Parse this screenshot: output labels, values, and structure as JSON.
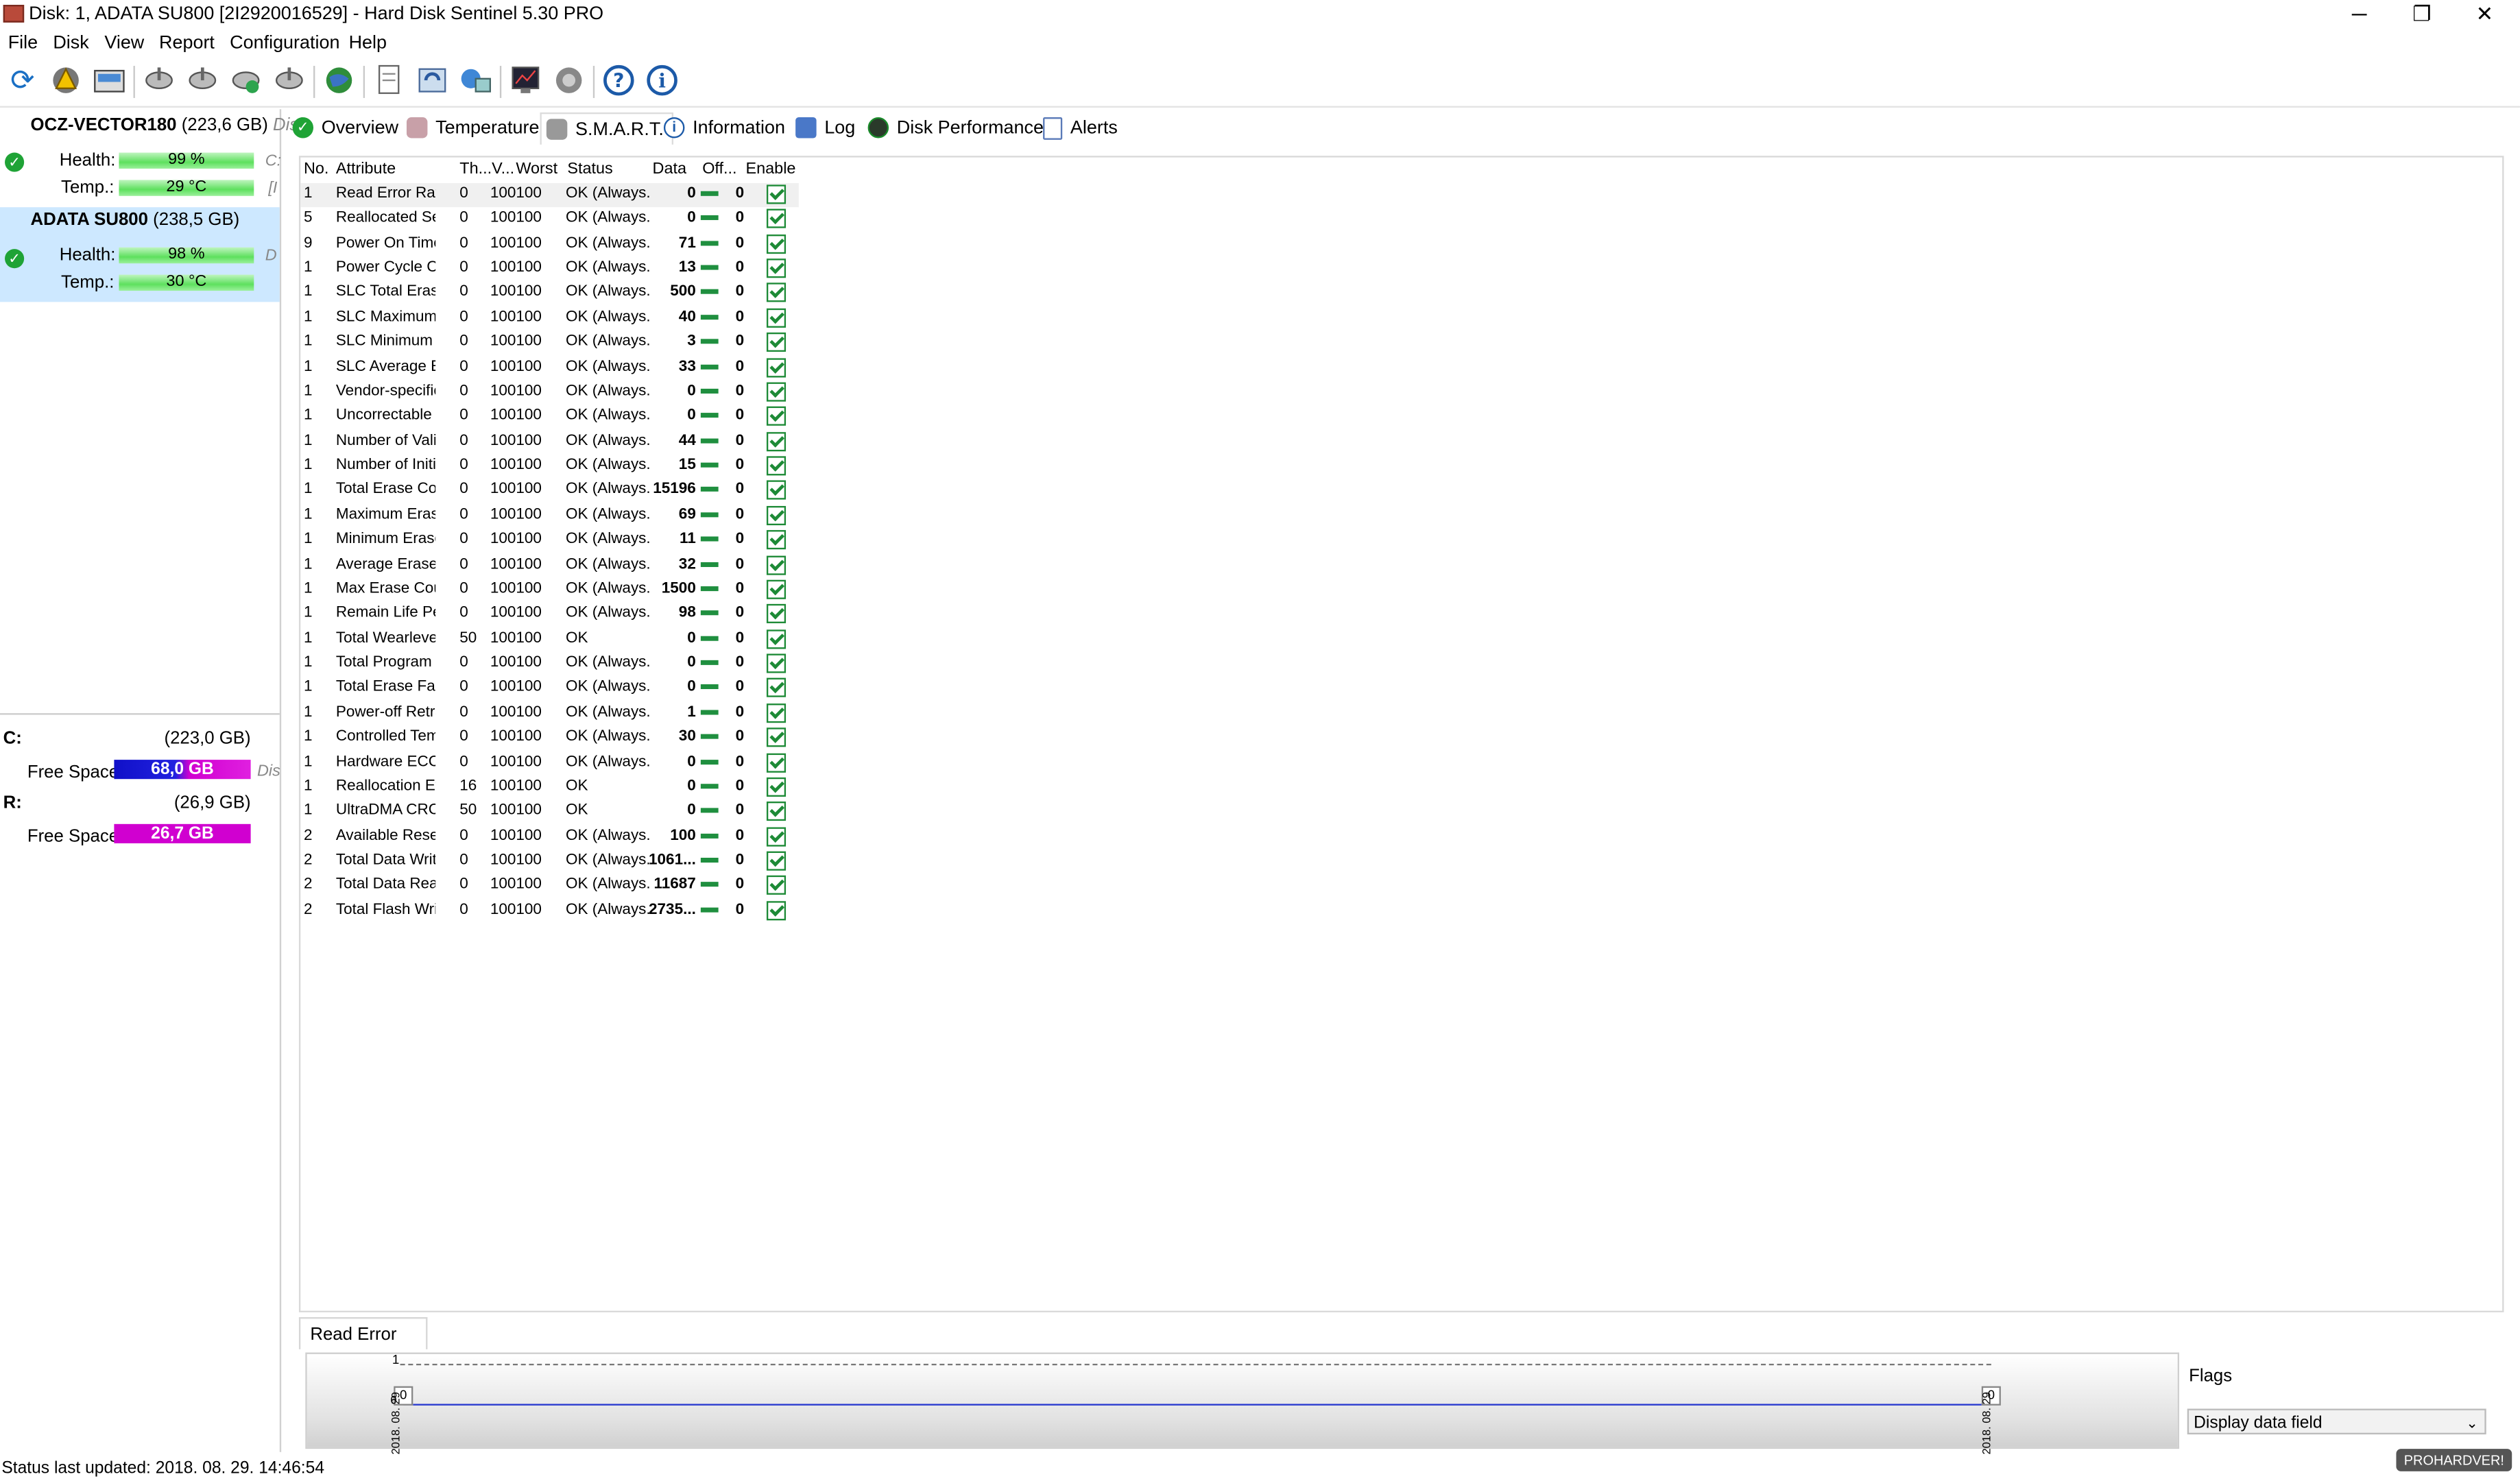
{
  "window": {
    "title": "Disk: 1, ADATA SU800 [2I2920016529]  -  Hard Disk Sentinel 5.30 PRO",
    "minimize": "─",
    "restore": "❐",
    "close": "✕"
  },
  "menu": [
    "File",
    "Disk",
    "View",
    "Report",
    "Configuration",
    "Help"
  ],
  "disks": [
    {
      "name": "OCZ-VECTOR180",
      "size": "(223,6 GB)",
      "tail": "Disk",
      "health_label": "Health:",
      "health": "99 %",
      "health_level": 0.99,
      "temp_label": "Temp.:",
      "temp": "29 °C",
      "side1": "C:",
      "side2": "[I"
    },
    {
      "name": "ADATA SU800",
      "size": "(238,5 GB)",
      "tail": "",
      "health_label": "Health:",
      "health": "98 %",
      "health_level": 0.98,
      "temp_label": "Temp.:",
      "temp": "30 °C",
      "side1": "D",
      "side2": ""
    }
  ],
  "volumes": [
    {
      "name": "C:",
      "size": "(223,0 GB)",
      "free_label": "Free Space",
      "free": "68,0 GB",
      "tail": "Dis"
    },
    {
      "name": "R:",
      "size": "(26,9 GB)",
      "free_label": "Free Space",
      "free": "26,7 GB",
      "tail": ""
    }
  ],
  "tabs": [
    "Overview",
    "Temperature",
    "S.M.A.R.T.",
    "Information",
    "Log",
    "Disk Performance",
    "Alerts"
  ],
  "smart": {
    "columns": [
      "No.",
      "Attribute",
      "Th...",
      "V...",
      "Worst",
      "Status",
      "Data",
      "Off...",
      "Enable"
    ],
    "rows": [
      [
        "1",
        "Read Error Rate",
        "0",
        "100",
        "100",
        "OK (Always...",
        "0",
        "0"
      ],
      [
        "5",
        "Reallocated Secto...",
        "0",
        "100",
        "100",
        "OK (Always...",
        "0",
        "0"
      ],
      [
        "9",
        "Power On Time C...",
        "0",
        "100",
        "100",
        "OK (Always...",
        "71",
        "0"
      ],
      [
        "1",
        "Power Cycle Count",
        "0",
        "100",
        "100",
        "OK (Always...",
        "13",
        "0"
      ],
      [
        "1",
        "SLC Total Erase C...",
        "0",
        "100",
        "100",
        "OK (Always...",
        "500",
        "0"
      ],
      [
        "1",
        "SLC Maximum Er...",
        "0",
        "100",
        "100",
        "OK (Always...",
        "40",
        "0"
      ],
      [
        "1",
        "SLC Minimum Era...",
        "0",
        "100",
        "100",
        "OK (Always...",
        "3",
        "0"
      ],
      [
        "1",
        "SLC Average Eras...",
        "0",
        "100",
        "100",
        "OK (Always...",
        "33",
        "0"
      ],
      [
        "1",
        "Vendor-specific",
        "0",
        "100",
        "100",
        "OK (Always...",
        "0",
        "0"
      ],
      [
        "1",
        "Uncorrectable Se...",
        "0",
        "100",
        "100",
        "OK (Always...",
        "0",
        "0"
      ],
      [
        "1",
        "Number of Valid ...",
        "0",
        "100",
        "100",
        "OK (Always...",
        "44",
        "0"
      ],
      [
        "1",
        "Number of Initial ...",
        "0",
        "100",
        "100",
        "OK (Always...",
        "15",
        "0"
      ],
      [
        "1",
        "Total Erase Count",
        "0",
        "100",
        "100",
        "OK (Always...",
        "15196",
        "0"
      ],
      [
        "1",
        "Maximum Erase ...",
        "0",
        "100",
        "100",
        "OK (Always...",
        "69",
        "0"
      ],
      [
        "1",
        "Minimum Erase C...",
        "0",
        "100",
        "100",
        "OK (Always...",
        "11",
        "0"
      ],
      [
        "1",
        "Average Erase Co...",
        "0",
        "100",
        "100",
        "OK (Always...",
        "32",
        "0"
      ],
      [
        "1",
        "Max Erase Count ...",
        "0",
        "100",
        "100",
        "OK (Always...",
        "1500",
        "0"
      ],
      [
        "1",
        "Remain Life Perc...",
        "0",
        "100",
        "100",
        "OK (Always...",
        "98",
        "0"
      ],
      [
        "1",
        "Total Wearlevel C...",
        "50",
        "100",
        "100",
        "OK",
        "0",
        "0"
      ],
      [
        "1",
        "Total Program Fai...",
        "0",
        "100",
        "100",
        "OK (Always...",
        "0",
        "0"
      ],
      [
        "1",
        "Total Erase Fail C...",
        "0",
        "100",
        "100",
        "OK (Always...",
        "0",
        "0"
      ],
      [
        "1",
        "Power-off Retract...",
        "0",
        "100",
        "100",
        "OK (Always...",
        "1",
        "0"
      ],
      [
        "1",
        "Controlled Tempe...",
        "0",
        "100",
        "100",
        "OK (Always...",
        "30",
        "0"
      ],
      [
        "1",
        "Hardware ECC Re...",
        "0",
        "100",
        "100",
        "OK (Always...",
        "0",
        "0"
      ],
      [
        "1",
        "Reallocation Even...",
        "16",
        "100",
        "100",
        "OK",
        "0",
        "0"
      ],
      [
        "1",
        "UltraDMA CRC Er...",
        "50",
        "100",
        "100",
        "OK",
        "0",
        "0"
      ],
      [
        "2",
        "Available Reserve...",
        "0",
        "100",
        "100",
        "OK (Always...",
        "100",
        "0"
      ],
      [
        "2",
        "Total Data Writte...",
        "0",
        "100",
        "100",
        "OK (Always...",
        "1061...",
        "0"
      ],
      [
        "2",
        "Total Data Read (...",
        "0",
        "100",
        "100",
        "OK (Always...",
        "11687",
        "0"
      ],
      [
        "2",
        "Total Flash Write ...",
        "0",
        "100",
        "100",
        "OK (Always...",
        "2735...",
        "0"
      ]
    ]
  },
  "graph": {
    "tab": "Read Error Rate",
    "y_top": "1",
    "left_val": "0",
    "right_val": "0",
    "left_date": "2018. 08. 29",
    "right_date": "2018. 08. 29",
    "marker": "0"
  },
  "flags": {
    "label": "Flags",
    "select": "Display data field"
  },
  "status": "Status last updated: 2018. 08. 29. 14:46:54",
  "watermark": "PROHARDVER!"
}
